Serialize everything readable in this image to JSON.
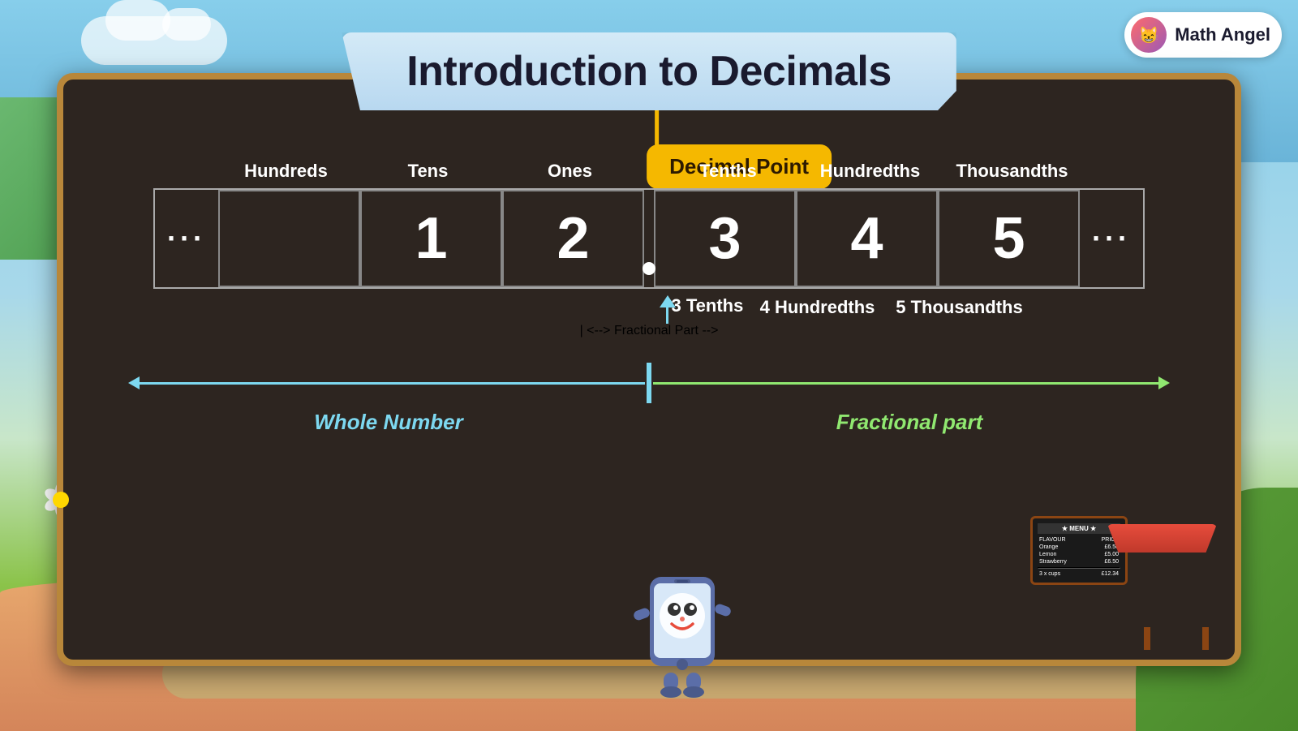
{
  "app": {
    "logo_text": "Math Angel",
    "logo_emoji": "😸"
  },
  "banner": {
    "title": "Introduction to Decimals"
  },
  "decimal_point_label": "Decimal Point",
  "columns": [
    {
      "id": "hundreds",
      "header": "Hundreds",
      "value": "",
      "show_digit": false
    },
    {
      "id": "tens",
      "header": "Tens",
      "value": "1",
      "show_digit": true
    },
    {
      "id": "ones",
      "header": "Ones",
      "value": "2",
      "show_digit": true
    },
    {
      "id": "tenths",
      "header": "Tenths",
      "value": "3",
      "show_digit": true
    },
    {
      "id": "hundredths",
      "header": "Hundredths",
      "value": "4",
      "show_digit": true
    },
    {
      "id": "thousandths",
      "header": "Thousandths",
      "value": "5",
      "show_digit": true
    }
  ],
  "ellipsis": "...",
  "annotations": [
    {
      "id": "tenths-annotation",
      "text": "3 Tenths"
    },
    {
      "id": "hundredths-annotation",
      "text": "4 Hundredths"
    },
    {
      "id": "thousandths-annotation",
      "text": "5 Thousandths"
    }
  ],
  "whole_number_label": "Whole Number",
  "fractional_part_label": "Fractional part",
  "menu": {
    "title": "MENU",
    "rows": [
      {
        "item": "FLAVOUR",
        "price": "PRICE"
      },
      {
        "item": "Orange",
        "price": "£6.50"
      },
      {
        "item": "Lemon",
        "price": "£5.00"
      },
      {
        "item": "Strawberry",
        "price": "£6.50"
      },
      {
        "item": "3 x cups",
        "price": "£12.34"
      }
    ]
  },
  "colors": {
    "accent_yellow": "#f5b800",
    "arrow_blue": "#7dd8f0",
    "arrow_green": "#90e870",
    "board_bg": "#2d2520",
    "board_border": "#b8873a",
    "white_text": "#ffffff",
    "annotation_white": "#ffffff"
  }
}
